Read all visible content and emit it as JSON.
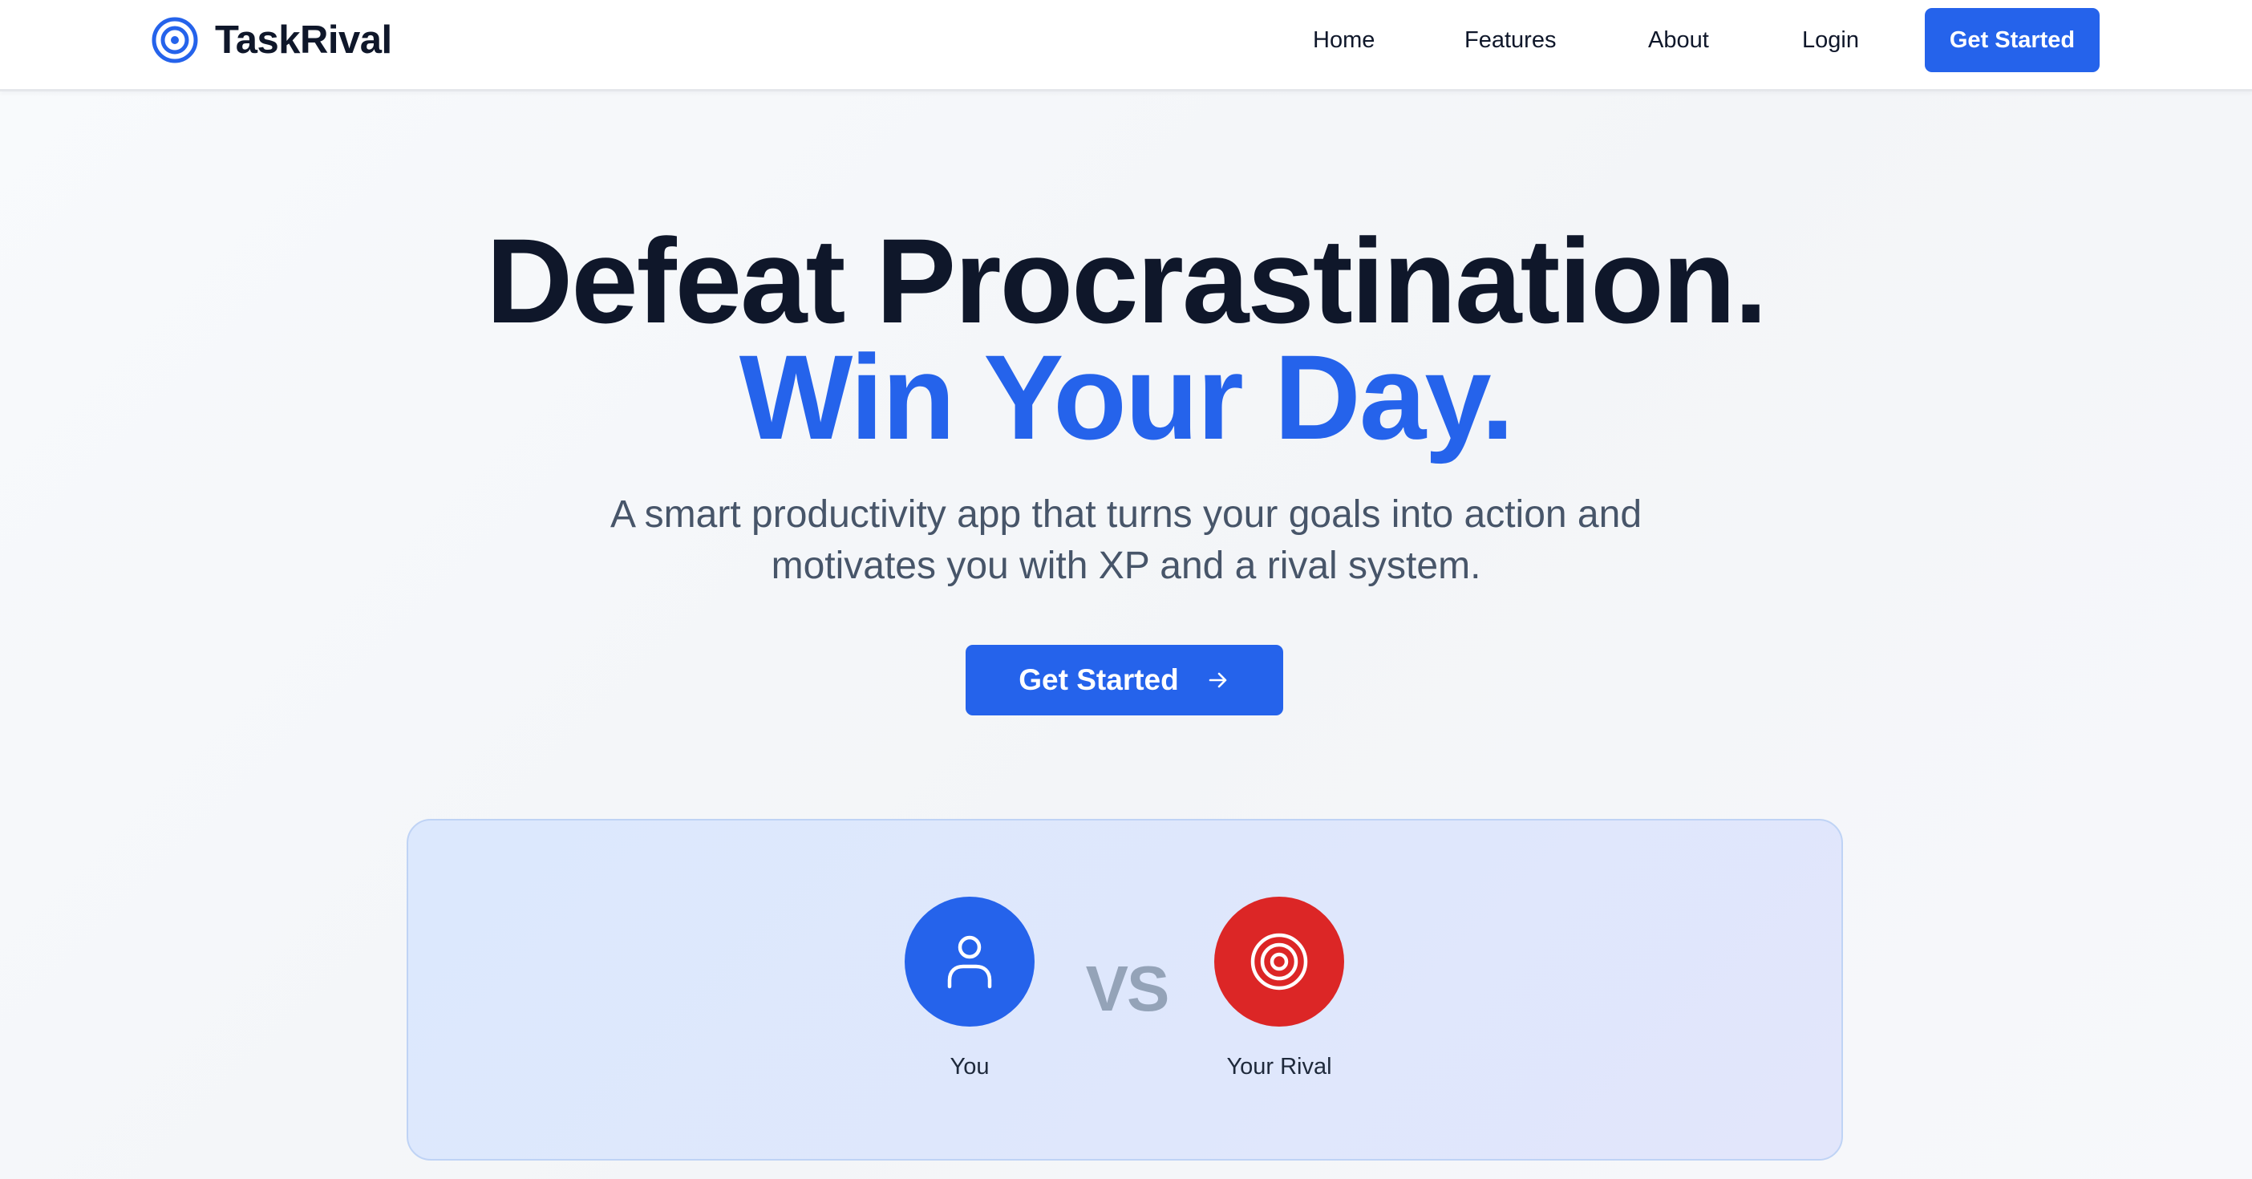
{
  "brand": {
    "name": "TaskRival",
    "icon": "target-icon",
    "accent_color": "#2563eb"
  },
  "nav": {
    "items": [
      {
        "label": "Home"
      },
      {
        "label": "Features"
      },
      {
        "label": "About"
      },
      {
        "label": "Login"
      }
    ],
    "cta_label": "Get Started"
  },
  "hero": {
    "headline_line1": "Defeat Procrastination.",
    "headline_line2": "Win Your Day.",
    "subtitle": "A smart productivity app that turns your goals into action and motivates you with XP and a rival system.",
    "cta_label": "Get Started",
    "cta_icon": "arrow-right-icon"
  },
  "versus": {
    "you_label": "You",
    "you_icon": "user-icon",
    "you_color": "#2563eb",
    "vs_text": "VS",
    "rival_label": "Your Rival",
    "rival_icon": "target-icon",
    "rival_color": "#dc2626"
  }
}
